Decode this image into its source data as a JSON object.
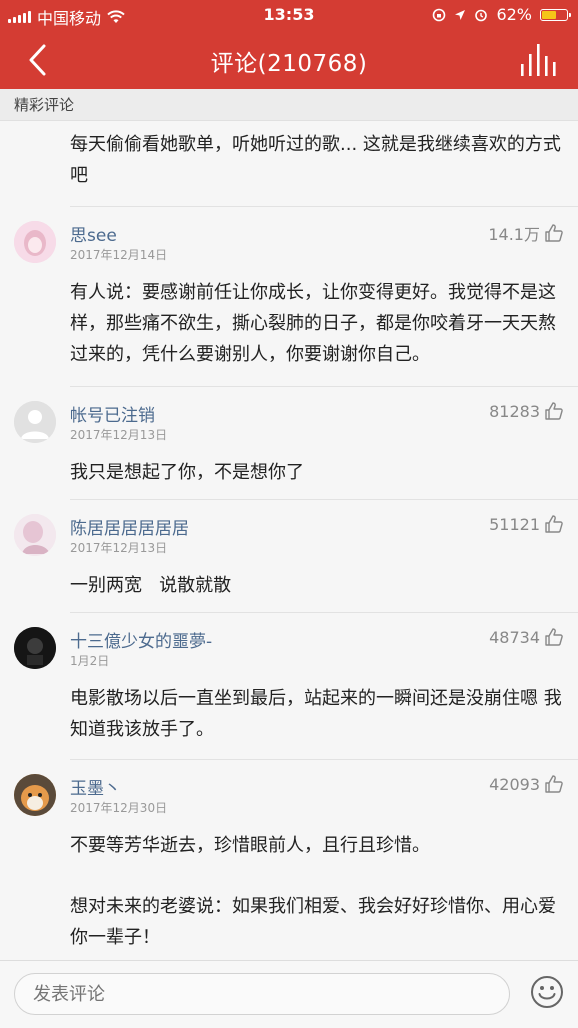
{
  "status": {
    "carrier": "中国移动",
    "time": "13:53",
    "battery": "62%",
    "battery_level": 0.62
  },
  "header": {
    "title": "评论(210768)"
  },
  "section": {
    "label": "精彩评论"
  },
  "comments": [
    {
      "user": "",
      "date": "",
      "likes": "",
      "text": "每天偷偷看她歌单，听她听过的歌... 这就是我继续喜欢的方式吧"
    },
    {
      "user": "思see",
      "date": "2017年12月14日",
      "likes": "14.1万",
      "text": "有人说：要感谢前任让你成长，让你变得更好。我觉得不是这样，那些痛不欲生，撕心裂肺的日子，都是你咬着牙一天天熬过来的，凭什么要谢别人，你要谢谢你自己。"
    },
    {
      "user": "帐号已注销",
      "date": "2017年12月13日",
      "likes": "81283",
      "text": "我只是想起了你，不是想你了"
    },
    {
      "user": "陈居居居居居居",
      "date": "2017年12月13日",
      "likes": "51121",
      "text": "一别两宽   说散就散"
    },
    {
      "user": "十三億少女的噩夢-",
      "date": "1月2日",
      "likes": "48734",
      "text": "电影散场以后一直坐到最后，站起来的一瞬间还是没崩住嗯 我知道我该放手了。"
    },
    {
      "user": "玉墨丶",
      "date": "2017年12月30日",
      "likes": "42093",
      "text": "不要等芳华逝去，珍惜眼前人，且行且珍惜。",
      "text2": "想对未来的老婆说：如果我们相爱、我会好好珍惜你、用心爱你一辈子！"
    }
  ],
  "composer": {
    "placeholder": "发表评论"
  }
}
